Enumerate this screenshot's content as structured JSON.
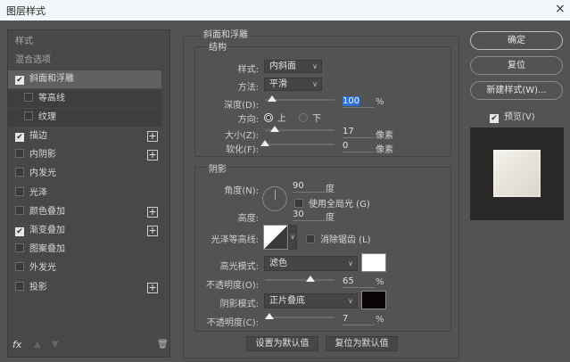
{
  "window": {
    "title": "图层样式",
    "close_icon": "×"
  },
  "sidebar": {
    "items": [
      {
        "label": "样式",
        "type": "header"
      },
      {
        "label": "混合选项",
        "type": "header"
      },
      {
        "label": "斜面和浮雕",
        "checked": true,
        "selected": true
      },
      {
        "label": "等高线",
        "checked": false,
        "sub": true
      },
      {
        "label": "纹理",
        "checked": false,
        "sub": true
      },
      {
        "label": "描边",
        "checked": true,
        "plus": true
      },
      {
        "label": "内阴影",
        "checked": false,
        "plus": true
      },
      {
        "label": "内发光",
        "checked": false
      },
      {
        "label": "光泽",
        "checked": false
      },
      {
        "label": "颜色叠加",
        "checked": false,
        "plus": true
      },
      {
        "label": "渐变叠加",
        "checked": true,
        "plus": true
      },
      {
        "label": "图案叠加",
        "checked": false
      },
      {
        "label": "外发光",
        "checked": false
      },
      {
        "label": "投影",
        "checked": false,
        "plus": true
      }
    ],
    "fx_label": "fx"
  },
  "bevel": {
    "title": "斜面和浮雕",
    "structure_title": "结构",
    "style_label": "样式:",
    "style_value": "内斜面",
    "technique_label": "方法:",
    "technique_value": "平滑",
    "depth_label": "深度(D):",
    "depth_value": "100",
    "depth_unit": "%",
    "depth_fraction": 0.1,
    "direction_label": "方向:",
    "direction_up": "上",
    "direction_down": "下",
    "size_label": "大小(Z):",
    "size_value": "17",
    "size_unit": "像素",
    "size_fraction": 0.14,
    "soften_label": "软化(F):",
    "soften_value": "0",
    "soften_unit": "像素",
    "soften_fraction": 0
  },
  "shading": {
    "title": "阴影",
    "angle_label": "角度(N):",
    "angle_value": "90",
    "angle_unit": "度",
    "global_light_label": "使用全局光 (G)",
    "altitude_label": "高度:",
    "altitude_value": "30",
    "altitude_unit": "度",
    "gloss_label": "光泽等高线:",
    "antialias_label": "消除锯齿 (L)",
    "highlight_label": "高光模式:",
    "highlight_value": "滤色",
    "highlight_color": "#ffffff",
    "hopacity_label": "不透明度(O):",
    "hopacity_value": "65",
    "hopacity_unit": "%",
    "hopacity_fraction": 0.65,
    "shadow_label": "阴影模式:",
    "shadow_value": "正片叠底",
    "shadow_color": "#0a0408",
    "sopacity_label": "不透明度(C):",
    "sopacity_value": "7",
    "sopacity_unit": "%",
    "sopacity_fraction": 0.07
  },
  "footer": {
    "set_default": "设置为默认值",
    "reset_default": "复位为默认值"
  },
  "actions": {
    "ok": "确定",
    "reset": "复位",
    "new_style": "新建样式(W)...",
    "preview": "预览(V)"
  }
}
